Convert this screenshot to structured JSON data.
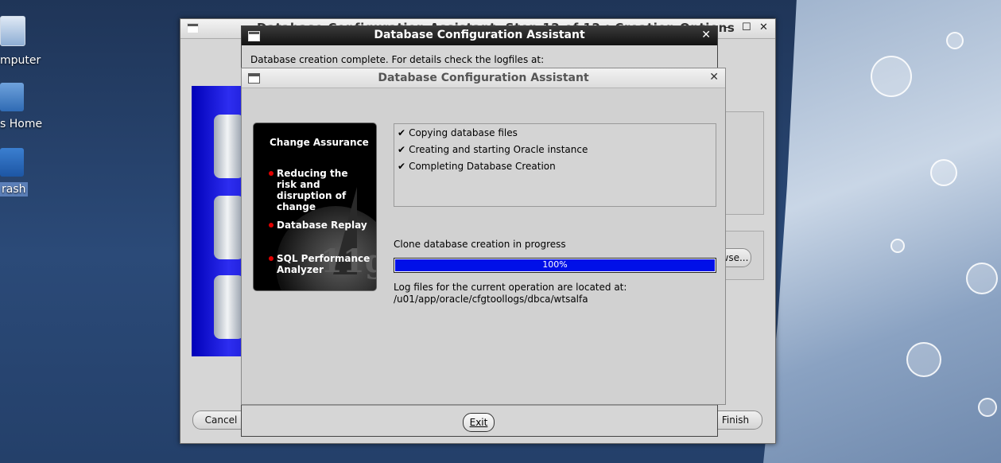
{
  "desktop": {
    "icons": [
      {
        "label": "mputer"
      },
      {
        "label": "s Home"
      },
      {
        "label": "rash"
      }
    ]
  },
  "back_window": {
    "title": "Database Configuration Assistant, Step 12 of 12 : Creation Options",
    "cancel_label": "Cancel",
    "finish_label": "Finish",
    "browse_label": "wse..."
  },
  "dialog_complete": {
    "title": "Database Configuration Assistant",
    "message": "Database creation complete. For details check the logfiles at:",
    "exit_label": "Exit"
  },
  "dialog_progress": {
    "title": "Database Configuration Assistant",
    "promo": {
      "heading": "Change Assurance",
      "items": [
        "Reducing the risk and disruption of change",
        "Database Replay",
        "SQL Performance Analyzer"
      ],
      "version_mark": "11g"
    },
    "steps": [
      {
        "check": "✔",
        "label": "Copying database files"
      },
      {
        "check": "✔",
        "label": "Creating and starting Oracle instance"
      },
      {
        "check": "✔",
        "label": "Completing Database Creation"
      }
    ],
    "progress_label": "Clone database creation in progress",
    "progress_percent": 100,
    "progress_text": "100%",
    "log_label": "Log files for the current operation are located at:",
    "log_path": "/u01/app/oracle/cfgtoollogs/dbca/wtsalfa"
  },
  "colors": {
    "progress_fill": "#0010e8",
    "promo_dot": "#e10000",
    "desktop_bg": "#24406a"
  }
}
